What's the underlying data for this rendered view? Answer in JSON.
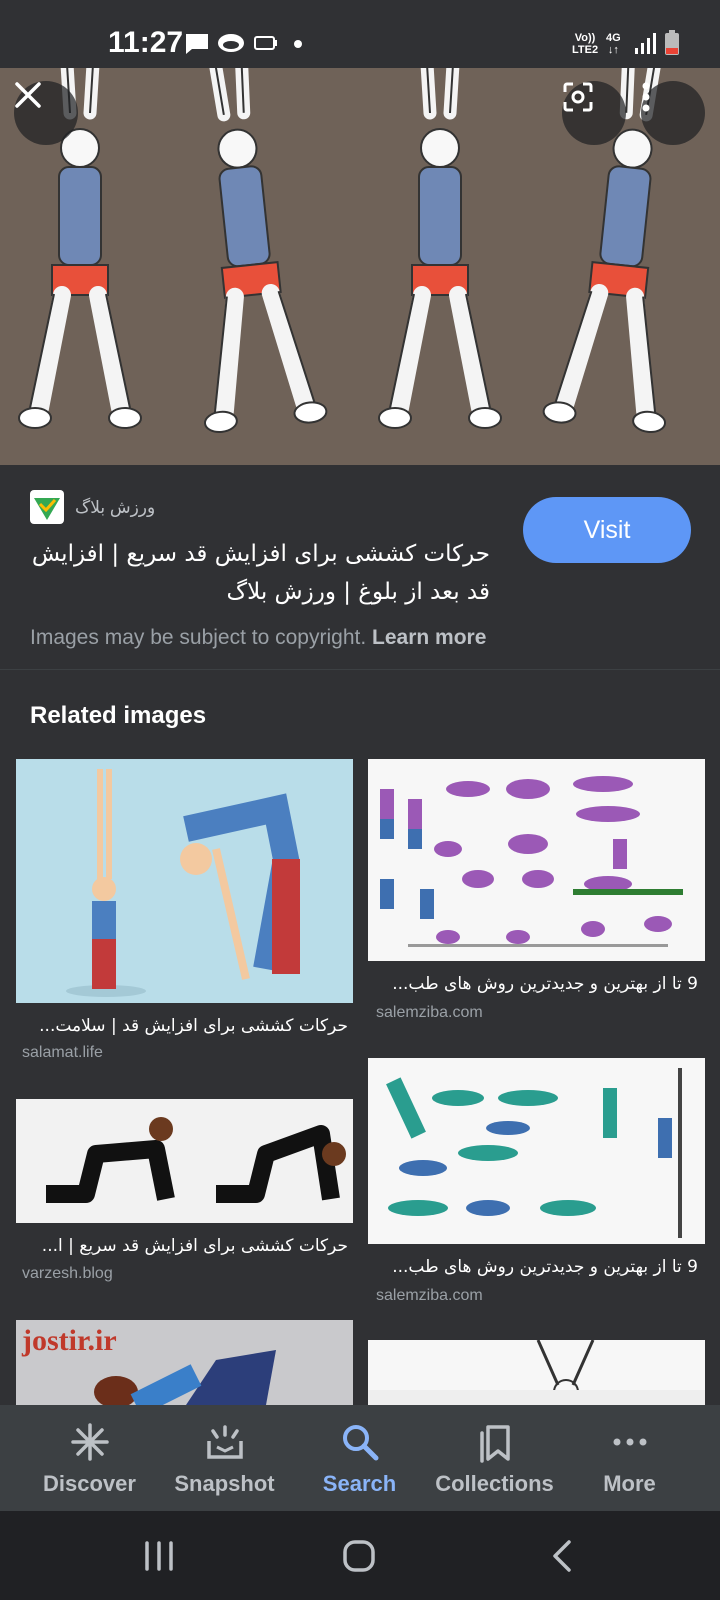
{
  "status_bar": {
    "time": "11:27",
    "network_top": "Vo))",
    "network_bottom": "LTE2",
    "gen_top": "4G",
    "gen_bottom": "↓↑"
  },
  "hero": {
    "close_icon": "close-icon",
    "lens_icon": "lens-icon",
    "menu_icon": "more-vert-icon"
  },
  "result": {
    "site_name": "ورزش بلاگ",
    "title": "حرکات کششی برای افزایش قد سریع | افزایش قد بعد از بلوغ | ورزش بلاگ",
    "visit_label": "Visit",
    "copyright_text": "Images may be subject to copyright.",
    "learn_more": "Learn more"
  },
  "related": {
    "heading": "Related images",
    "items": [
      {
        "title": "حرکات کششی برای افزایش قد | سلامت...",
        "domain": "salamat.life"
      },
      {
        "title": "9 تا از بهترین و جدیدترین روش های طب...",
        "domain": "salemziba.com"
      },
      {
        "title": "حرکات کششی برای افزایش قد سریع | ا...",
        "domain": "varzesh.blog"
      },
      {
        "title": "9 تا از بهترین و جدیدترین روش های طب...",
        "domain": "salemziba.com"
      },
      {
        "title": "jostir.ir",
        "domain": ""
      }
    ]
  },
  "bottom_nav": {
    "items": [
      {
        "label": "Discover",
        "icon": "asterisk-icon"
      },
      {
        "label": "Snapshot",
        "icon": "snapshot-icon"
      },
      {
        "label": "Search",
        "icon": "search-icon"
      },
      {
        "label": "Collections",
        "icon": "bookmarks-icon"
      },
      {
        "label": "More",
        "icon": "more-horiz-icon"
      }
    ],
    "active": "Search"
  },
  "colors": {
    "accent": "#8ab4f8",
    "visit_button": "#5e97f6",
    "surface": "#303134"
  }
}
